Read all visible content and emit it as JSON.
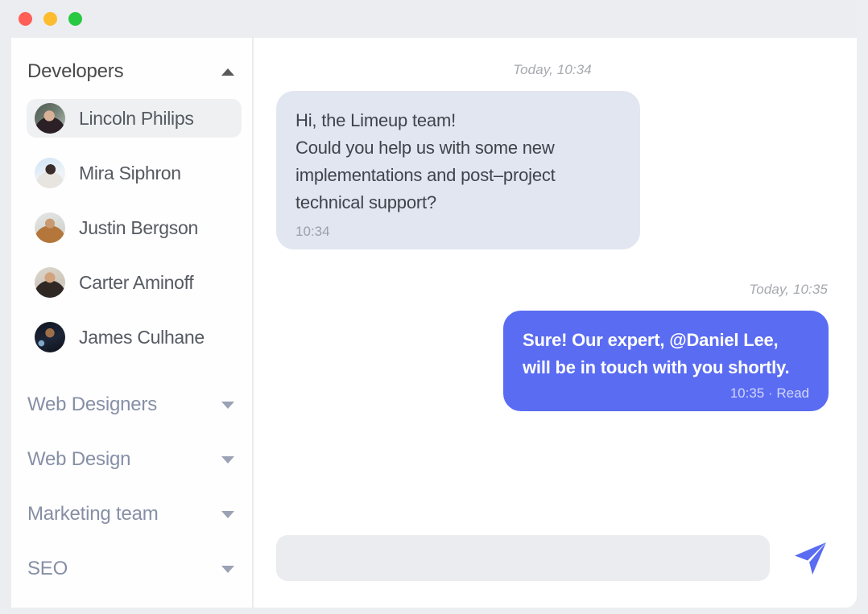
{
  "window": {
    "controls": [
      {
        "name": "close",
        "color": "#ff5f57"
      },
      {
        "name": "minimize",
        "color": "#fdbc2e"
      },
      {
        "name": "maximize",
        "color": "#28c840"
      }
    ]
  },
  "sidebar": {
    "active_group": {
      "label": "Developers",
      "expanded": true,
      "caret_icon": "chevron-up-icon"
    },
    "contacts": [
      {
        "name": "Lincoln Philips",
        "selected": true
      },
      {
        "name": "Mira Siphron",
        "selected": false
      },
      {
        "name": "Justin Bergson",
        "selected": false
      },
      {
        "name": "Carter Aminoff",
        "selected": false
      },
      {
        "name": "James Culhane",
        "selected": false
      }
    ],
    "collapsed_groups": [
      {
        "label": "Web Designers",
        "caret_icon": "chevron-down-icon"
      },
      {
        "label": "Web Design",
        "caret_icon": "chevron-down-icon"
      },
      {
        "label": "Marketing team",
        "caret_icon": "chevron-down-icon"
      },
      {
        "label": "SEO",
        "caret_icon": "chevron-down-icon"
      }
    ]
  },
  "chat": {
    "messages": [
      {
        "direction": "incoming",
        "daystamp": "Today, 10:34",
        "text": "Hi, the Limeup team!\nCould you help us with some new implementations and post–project technical support?",
        "meta": "10:34"
      },
      {
        "direction": "outgoing",
        "daystamp": "Today, 10:35",
        "text_before_mention": "Sure! Our expert, ",
        "mention": "@Daniel Lee",
        "text_after_mention": ", will be in touch with you shortly.",
        "meta": "10:35 · Read"
      }
    ],
    "composer": {
      "value": "",
      "placeholder": "",
      "send_icon": "send-paper-plane-icon"
    }
  },
  "colors": {
    "accent": "#5a6cf2",
    "incoming_bubble": "#e2e6f0",
    "selected_item": "#eef0f2",
    "page_background": "#ebedf0",
    "group_label_muted": "#868fa5"
  }
}
